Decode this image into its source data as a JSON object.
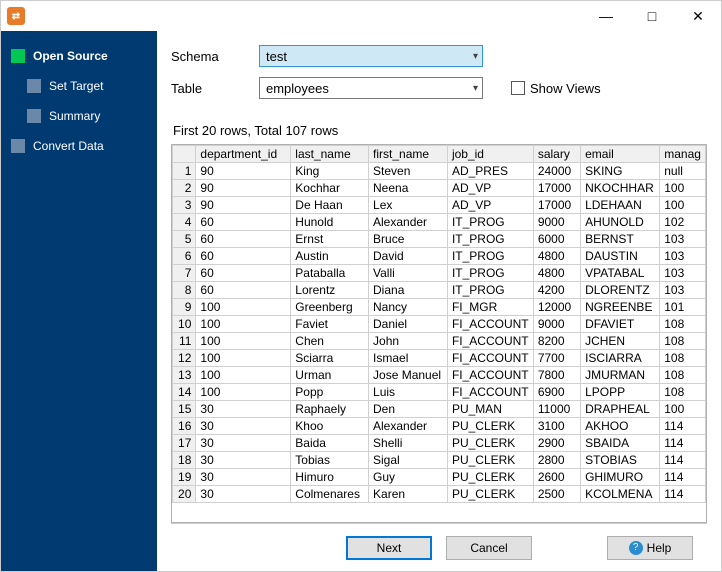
{
  "sidebar": {
    "items": [
      {
        "label": "Open Source",
        "active": true,
        "child": false
      },
      {
        "label": "Set Target",
        "active": false,
        "child": true
      },
      {
        "label": "Summary",
        "active": false,
        "child": true
      },
      {
        "label": "Convert Data",
        "active": false,
        "child": false
      }
    ]
  },
  "form": {
    "schema_label": "Schema",
    "schema_value": "test",
    "table_label": "Table",
    "table_value": "employees",
    "show_views_label": "Show Views",
    "show_views_checked": false
  },
  "summary": "First 20 rows, Total 107 rows",
  "columns": [
    "department_id",
    "last_name",
    "first_name",
    "job_id",
    "salary",
    "email",
    "manager_id"
  ],
  "rows": [
    [
      "90",
      "King",
      "Steven",
      "AD_PRES",
      "24000",
      "SKING",
      "null"
    ],
    [
      "90",
      "Kochhar",
      "Neena",
      "AD_VP",
      "17000",
      "NKOCHHAR",
      "100"
    ],
    [
      "90",
      "De Haan",
      "Lex",
      "AD_VP",
      "17000",
      "LDEHAAN",
      "100"
    ],
    [
      "60",
      "Hunold",
      "Alexander",
      "IT_PROG",
      "9000",
      "AHUNOLD",
      "102"
    ],
    [
      "60",
      "Ernst",
      "Bruce",
      "IT_PROG",
      "6000",
      "BERNST",
      "103"
    ],
    [
      "60",
      "Austin",
      "David",
      "IT_PROG",
      "4800",
      "DAUSTIN",
      "103"
    ],
    [
      "60",
      "Pataballa",
      "Valli",
      "IT_PROG",
      "4800",
      "VPATABAL",
      "103"
    ],
    [
      "60",
      "Lorentz",
      "Diana",
      "IT_PROG",
      "4200",
      "DLORENTZ",
      "103"
    ],
    [
      "100",
      "Greenberg",
      "Nancy",
      "FI_MGR",
      "12000",
      "NGREENBE",
      "101"
    ],
    [
      "100",
      "Faviet",
      "Daniel",
      "FI_ACCOUNT",
      "9000",
      "DFAVIET",
      "108"
    ],
    [
      "100",
      "Chen",
      "John",
      "FI_ACCOUNT",
      "8200",
      "JCHEN",
      "108"
    ],
    [
      "100",
      "Sciarra",
      "Ismael",
      "FI_ACCOUNT",
      "7700",
      "ISCIARRA",
      "108"
    ],
    [
      "100",
      "Urman",
      "Jose Manuel",
      "FI_ACCOUNT",
      "7800",
      "JMURMAN",
      "108"
    ],
    [
      "100",
      "Popp",
      "Luis",
      "FI_ACCOUNT",
      "6900",
      "LPOPP",
      "108"
    ],
    [
      "30",
      "Raphaely",
      "Den",
      "PU_MAN",
      "11000",
      "DRAPHEAL",
      "100"
    ],
    [
      "30",
      "Khoo",
      "Alexander",
      "PU_CLERK",
      "3100",
      "AKHOO",
      "114"
    ],
    [
      "30",
      "Baida",
      "Shelli",
      "PU_CLERK",
      "2900",
      "SBAIDA",
      "114"
    ],
    [
      "30",
      "Tobias",
      "Sigal",
      "PU_CLERK",
      "2800",
      "STOBIAS",
      "114"
    ],
    [
      "30",
      "Himuro",
      "Guy",
      "PU_CLERK",
      "2600",
      "GHIMURO",
      "114"
    ],
    [
      "30",
      "Colmenares",
      "Karen",
      "PU_CLERK",
      "2500",
      "KCOLMENA",
      "114"
    ]
  ],
  "footer": {
    "next": "Next",
    "cancel": "Cancel",
    "help": "Help"
  }
}
